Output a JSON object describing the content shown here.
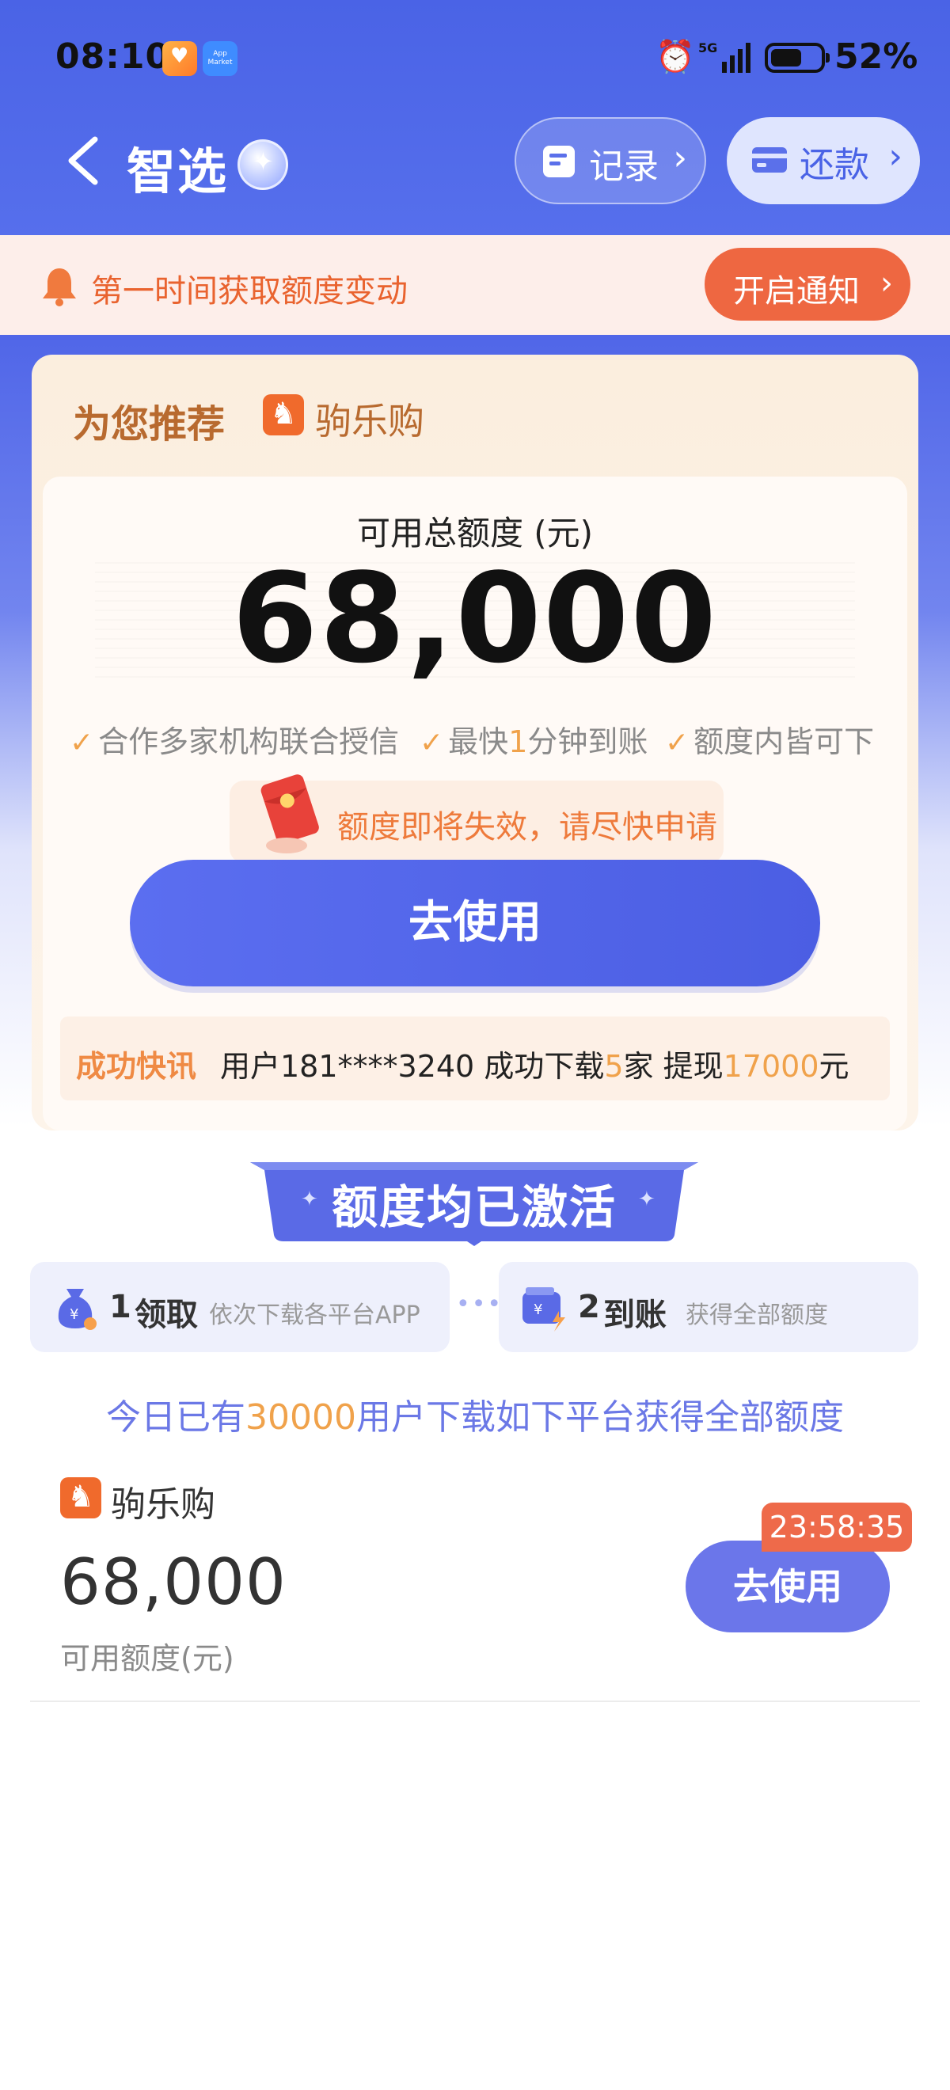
{
  "status_bar": {
    "time": "08:10",
    "battery": "52%",
    "network": "5G",
    "app_badge_text": "App Market"
  },
  "nav": {
    "title": "智选",
    "record_label": "记录",
    "repay_label": "还款"
  },
  "notify": {
    "text": "第一时间获取额度变动",
    "button_label": "开启通知"
  },
  "recommend": {
    "title": "为您推荐",
    "brand": "驹乐购",
    "credit_label": "可用总额度 (元)",
    "credit_amount": "68,000",
    "features": [
      {
        "pre": "合作多家机构联合授信",
        "hl": "",
        "post": ""
      },
      {
        "pre": "最快",
        "hl": "1",
        "post": "分钟到账"
      },
      {
        "pre": "额度内皆可下",
        "hl": "",
        "post": ""
      }
    ],
    "warning": "额度即将失效，请尽快申请",
    "use_button": "去使用",
    "news_title": "成功快讯",
    "news": {
      "p1": "用户181****3240 成功下载",
      "n1": "5",
      "p2": "家 提现",
      "n2": "17000",
      "p3": "元"
    }
  },
  "activated": {
    "banner": "额度均已激活",
    "steps": [
      {
        "num": "1",
        "name": "领取",
        "desc": "依次下载各平台APP"
      },
      {
        "num": "2",
        "name": "到账",
        "desc": "获得全部额度"
      }
    ],
    "today": {
      "pre": "今日已有",
      "hl": "30000",
      "post": "用户下载如下平台获得全部额度"
    }
  },
  "product": {
    "name": "驹乐购",
    "amount": "68,000",
    "amount_label": "可用额度(元)",
    "button": "去使用",
    "timer": "23:58:35"
  },
  "colors": {
    "primary_blue": "#4a63e6",
    "accent_orange": "#ee6741",
    "highlight_gold": "#f0a24b"
  }
}
